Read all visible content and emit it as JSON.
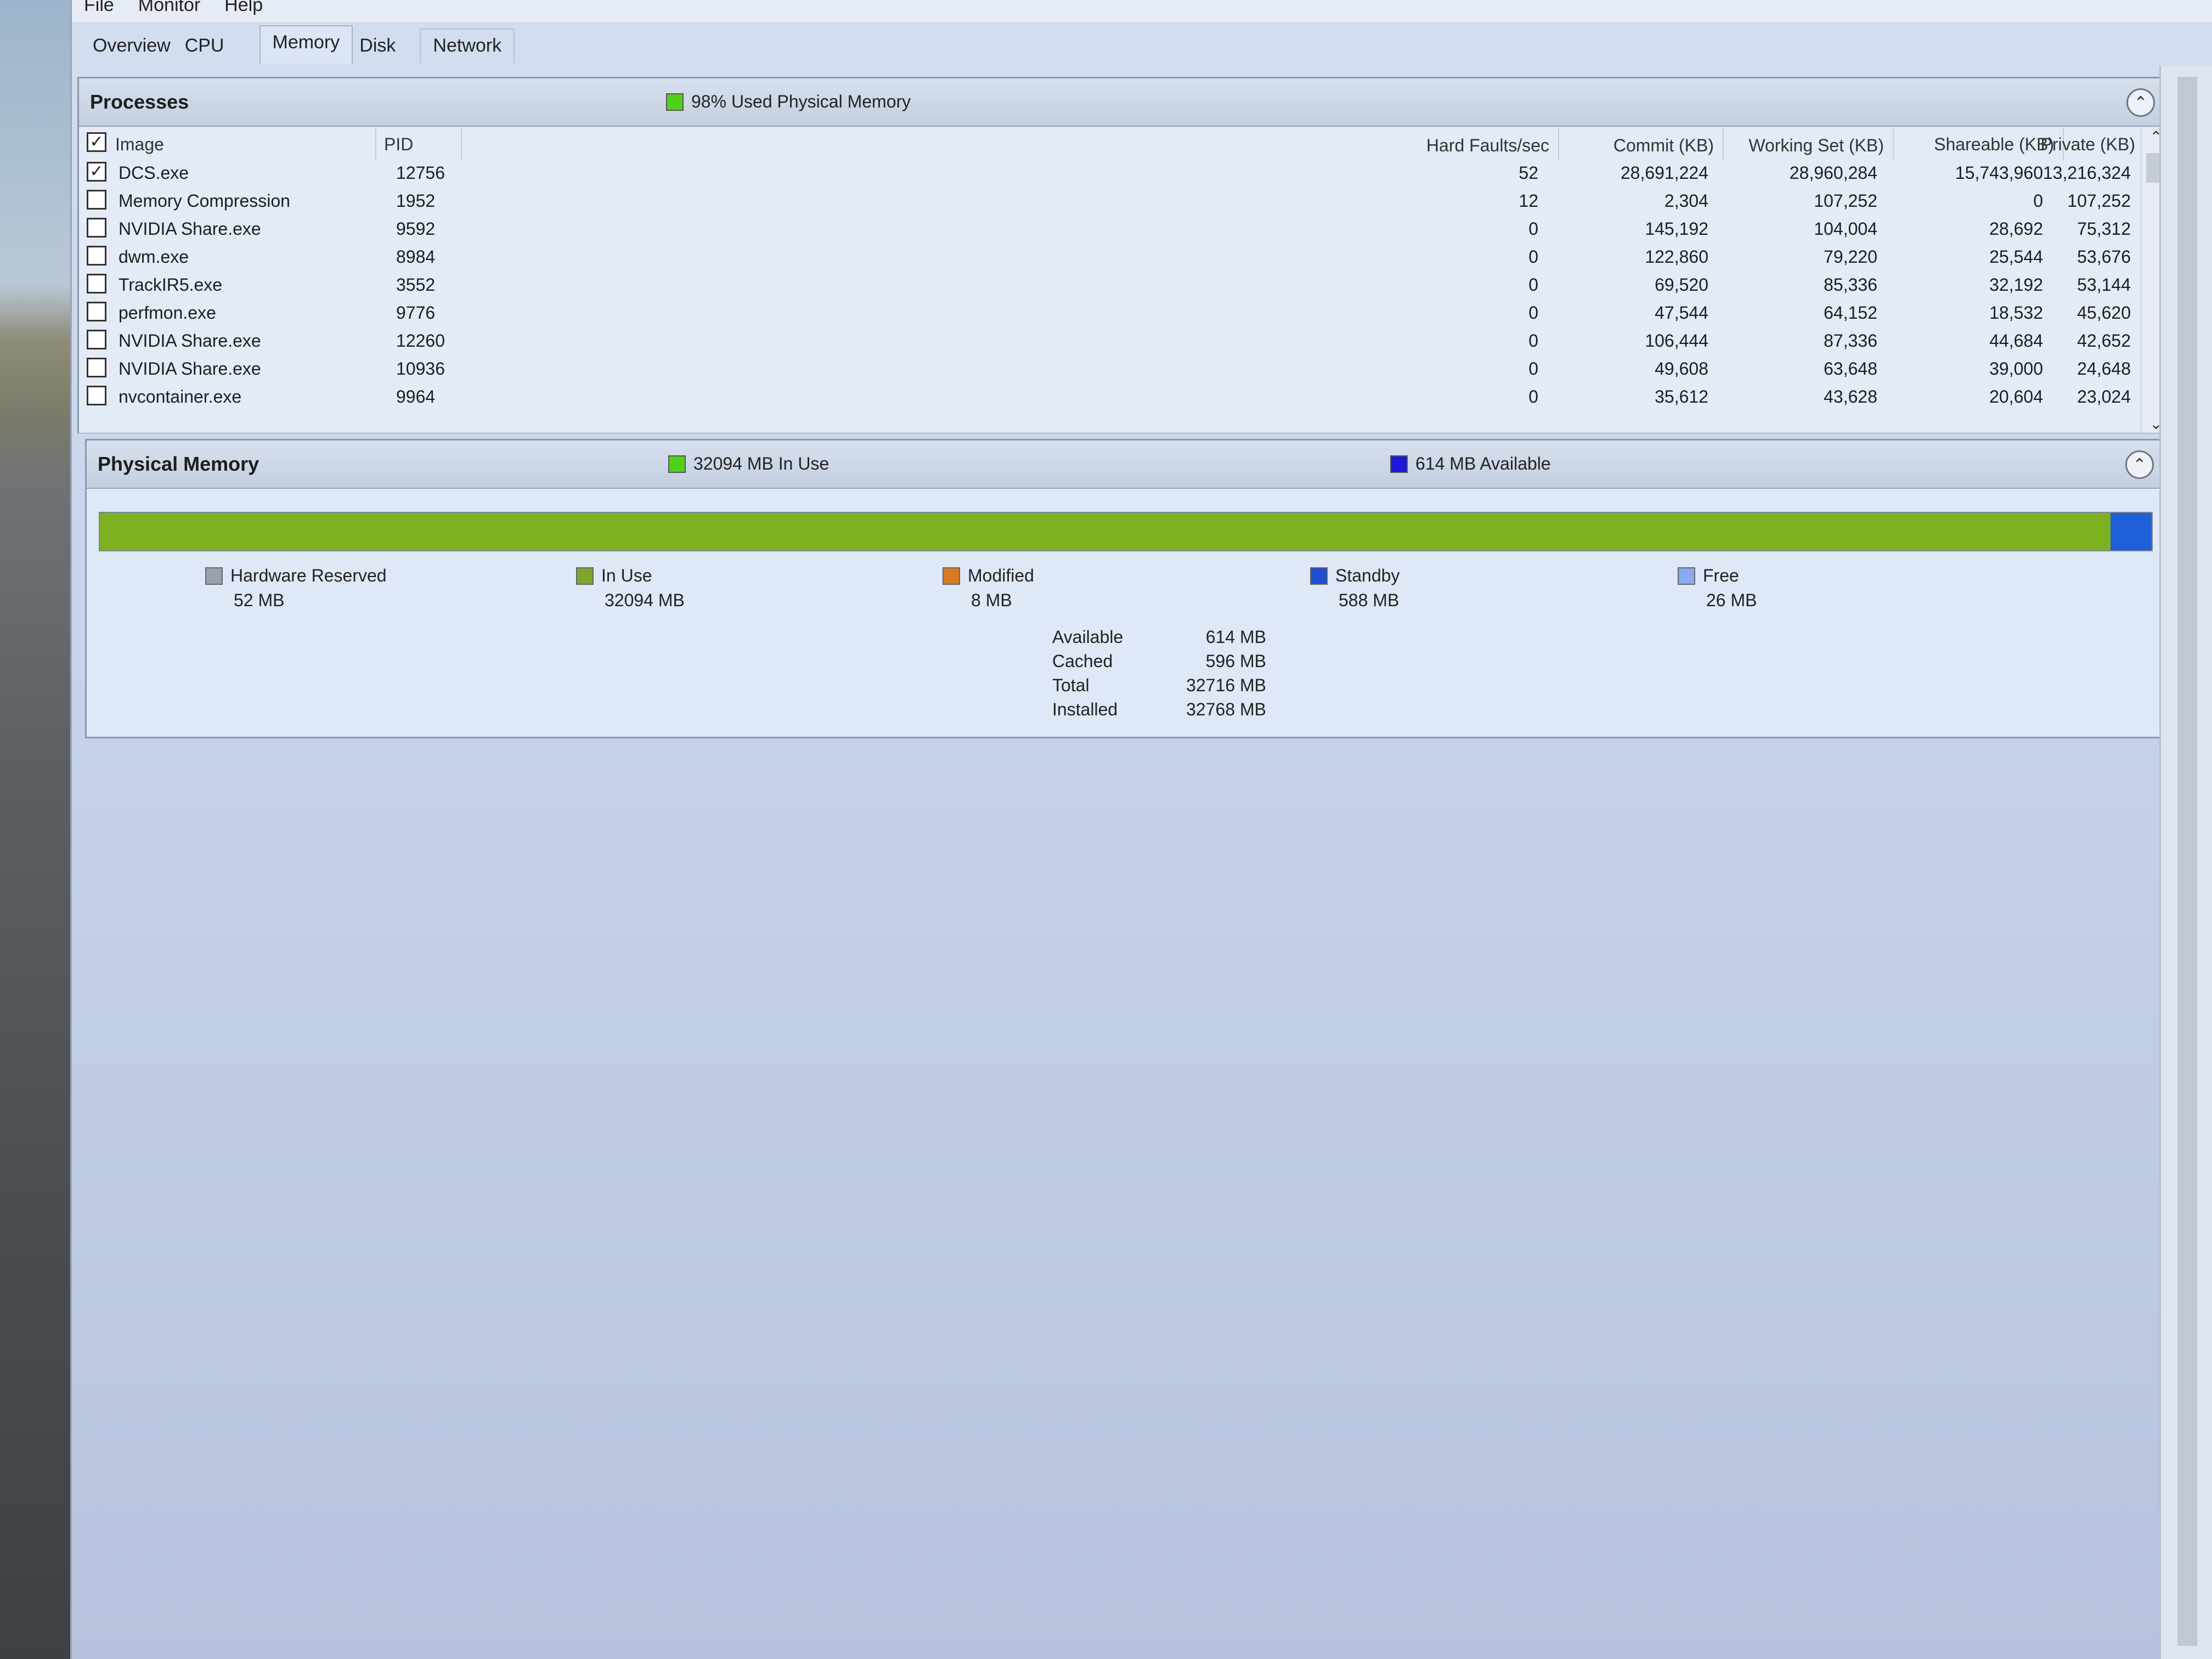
{
  "menu": [
    "File",
    "Monitor",
    "Help"
  ],
  "tabs": [
    {
      "label": "Overview",
      "active": false
    },
    {
      "label": "CPU",
      "active": false
    },
    {
      "label": "Memory",
      "active": true
    },
    {
      "label": "Disk",
      "active": false
    },
    {
      "label": "Network",
      "active": false
    }
  ],
  "processes": {
    "title": "Processes",
    "summary": "98% Used Physical Memory",
    "summary_color": "#4fd11a",
    "columns": {
      "image": "Image",
      "pid": "PID",
      "hard_faults": "Hard Faults/sec",
      "commit": "Commit (KB)",
      "working_set": "Working Set (KB)",
      "shareable": "Shareable (KB)",
      "private": "Private (KB)"
    },
    "rows": [
      {
        "checked": true,
        "image": "DCS.exe",
        "pid": "12756",
        "hard_faults": "52",
        "commit": "28,691,224",
        "working_set": "28,960,284",
        "shareable": "15,743,960",
        "private": "13,216,324"
      },
      {
        "checked": false,
        "image": "Memory Compression",
        "pid": "1952",
        "hard_faults": "12",
        "commit": "2,304",
        "working_set": "107,252",
        "shareable": "0",
        "private": "107,252"
      },
      {
        "checked": false,
        "image": "NVIDIA Share.exe",
        "pid": "9592",
        "hard_faults": "0",
        "commit": "145,192",
        "working_set": "104,004",
        "shareable": "28,692",
        "private": "75,312"
      },
      {
        "checked": false,
        "image": "dwm.exe",
        "pid": "8984",
        "hard_faults": "0",
        "commit": "122,860",
        "working_set": "79,220",
        "shareable": "25,544",
        "private": "53,676"
      },
      {
        "checked": false,
        "image": "TrackIR5.exe",
        "pid": "3552",
        "hard_faults": "0",
        "commit": "69,520",
        "working_set": "85,336",
        "shareable": "32,192",
        "private": "53,144"
      },
      {
        "checked": false,
        "image": "perfmon.exe",
        "pid": "9776",
        "hard_faults": "0",
        "commit": "47,544",
        "working_set": "64,152",
        "shareable": "18,532",
        "private": "45,620"
      },
      {
        "checked": false,
        "image": "NVIDIA Share.exe",
        "pid": "12260",
        "hard_faults": "0",
        "commit": "106,444",
        "working_set": "87,336",
        "shareable": "44,684",
        "private": "42,652"
      },
      {
        "checked": false,
        "image": "NVIDIA Share.exe",
        "pid": "10936",
        "hard_faults": "0",
        "commit": "49,608",
        "working_set": "63,648",
        "shareable": "39,000",
        "private": "24,648"
      },
      {
        "checked": false,
        "image": "nvcontainer.exe",
        "pid": "9964",
        "hard_faults": "0",
        "commit": "35,612",
        "working_set": "43,628",
        "shareable": "20,604",
        "private": "23,024"
      }
    ]
  },
  "physical_memory": {
    "title": "Physical Memory",
    "in_use_summary": "32094 MB In Use",
    "in_use_color": "#4fd11a",
    "available_summary": "614 MB Available",
    "available_color": "#1a1ad8",
    "bar_in_use_fraction": 0.98,
    "bar_colors": {
      "in_use": "#7db11f",
      "standby": "#1f5fd8"
    },
    "legend": [
      {
        "label": "Hardware Reserved",
        "value": "52 MB",
        "color": "#9aa0ae"
      },
      {
        "label": "In Use",
        "value": "32094 MB",
        "color": "#7da62a"
      },
      {
        "label": "Modified",
        "value": "8 MB",
        "color": "#d77a22"
      },
      {
        "label": "Standby",
        "value": "588 MB",
        "color": "#1f4fd0"
      },
      {
        "label": "Free",
        "value": "26 MB",
        "color": "#8aaaf0"
      }
    ],
    "summary": [
      {
        "key": "Available",
        "value": "614 MB"
      },
      {
        "key": "Cached",
        "value": "596 MB"
      },
      {
        "key": "Total",
        "value": "32716 MB"
      },
      {
        "key": "Installed",
        "value": "32768 MB"
      }
    ]
  }
}
